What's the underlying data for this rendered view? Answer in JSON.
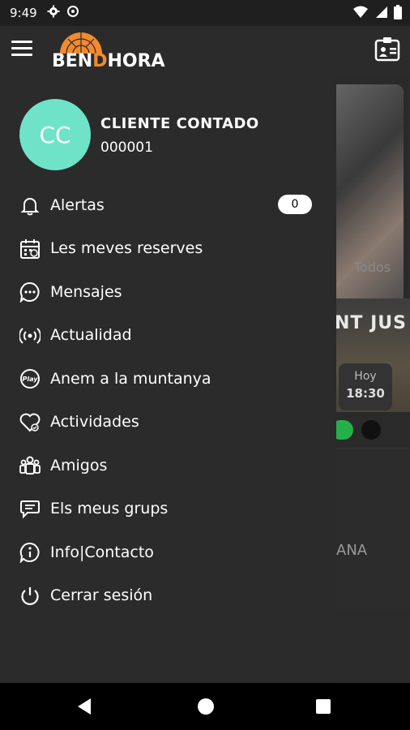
{
  "status_bar": {
    "time": "9:49",
    "icons_left": [
      "gear-icon",
      "data-saver-icon"
    ],
    "icons_right": [
      "wifi-icon",
      "signal-icon",
      "battery-icon"
    ]
  },
  "app_bar": {
    "logo_text_prefix": "BEN",
    "logo_text_accent": "D",
    "logo_text_suffix": "HORA",
    "accent_color": "#f28a2e"
  },
  "user": {
    "initials": "CC",
    "name": "CLIENTE CONTADO",
    "id": "000001",
    "avatar_color": "#6fe3c7"
  },
  "menu": {
    "items": [
      {
        "label": "Alertas",
        "icon": "bell-icon",
        "badge": "0"
      },
      {
        "label": "Les meves reserves",
        "icon": "calendar-icon"
      },
      {
        "label": "Mensajes",
        "icon": "chat-bubble-icon"
      },
      {
        "label": "Actualidad",
        "icon": "broadcast-icon"
      },
      {
        "label": "Anem a la muntanya",
        "icon": "play-icon"
      },
      {
        "label": "Actividades",
        "icon": "heart-icon"
      },
      {
        "label": "Amigos",
        "icon": "people-icon"
      },
      {
        "label": "Els meus grups",
        "icon": "group-chat-icon"
      },
      {
        "label": "Info|Contacto",
        "icon": "info-icon"
      },
      {
        "label": "Cerrar sesión",
        "icon": "power-icon"
      }
    ]
  },
  "background": {
    "filter_tab": "Todos",
    "event_title": "NT JUS",
    "event_day": "Hoy",
    "event_time": "18:30",
    "lower_text": "ANA"
  }
}
